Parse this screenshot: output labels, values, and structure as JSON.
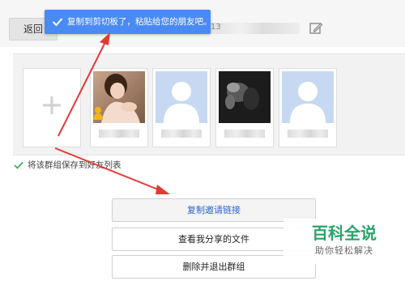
{
  "header": {
    "back_label": "返回",
    "group_name_fragment": "13"
  },
  "toast": {
    "message": "复制到剪切板了，粘贴给您的朋友吧。"
  },
  "members": [
    {
      "avatar": "photo-portrait",
      "is_owner": true
    },
    {
      "avatar": "default-avatar",
      "is_owner": false
    },
    {
      "avatar": "photo-dark",
      "is_owner": false
    },
    {
      "avatar": "default-avatar",
      "is_owner": false
    }
  ],
  "options": {
    "save_group_label": "将该群组保存到好友列表",
    "save_group_checked": true
  },
  "actions": {
    "copy_invite_label": "复制邀请链接",
    "view_shared_label": "查看我分享的文件",
    "leave_group_label": "删除并退出群组"
  },
  "watermark": {
    "brand": "百科全说",
    "slogan": "助你轻松解决"
  },
  "colors": {
    "toast_bg": "#4a8af4",
    "arrow": "#e53935",
    "check_green": "#3bb35a",
    "link_blue": "#2a66c9",
    "watermark_green": "#2aa36b"
  }
}
